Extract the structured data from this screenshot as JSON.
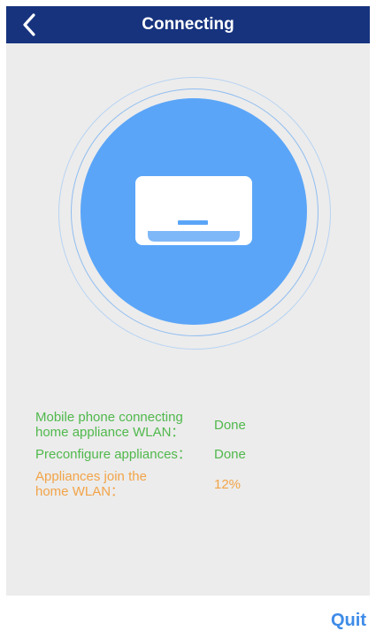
{
  "header": {
    "title": "Connecting",
    "back_icon": "chevron-left-icon"
  },
  "device": {
    "icon": "air-conditioner-icon"
  },
  "status": [
    {
      "label": "Mobile phone connecting\nhome appliance WLAN：",
      "value": "Done",
      "state": "done"
    },
    {
      "label": "Preconfigure appliances：",
      "value": "Done",
      "state": "done"
    },
    {
      "label": "Appliances join the\nhome WLAN：",
      "value": "12%",
      "state": "in-progress"
    }
  ],
  "footer": {
    "quit_label": "Quit"
  },
  "colors": {
    "header_bg": "#17337e",
    "done": "#50b84c",
    "in_progress": "#f2a448",
    "accent": "#3d8be8",
    "circle": "#5aa5f8"
  }
}
